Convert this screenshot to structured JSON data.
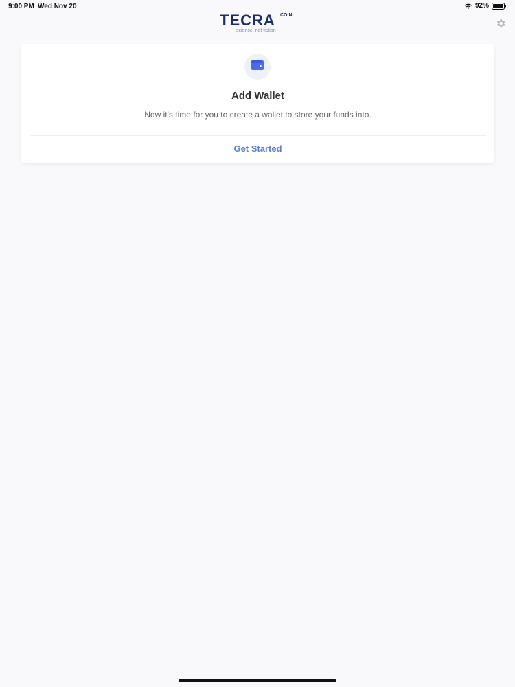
{
  "status_bar": {
    "time": "9:00 PM",
    "date": "Wed Nov 20",
    "battery": "92%"
  },
  "logo": {
    "word": "TECRA",
    "superscript": "COIN",
    "tagline": "science, not fiction"
  },
  "card": {
    "icon": "wallet-icon",
    "title": "Add Wallet",
    "description": "Now it's time for you to create a wallet to store your funds into.",
    "action_label": "Get Started"
  },
  "colors": {
    "accent": "#5b7fd6",
    "brand": "#1c2d6b",
    "background": "#f9f9fc"
  }
}
